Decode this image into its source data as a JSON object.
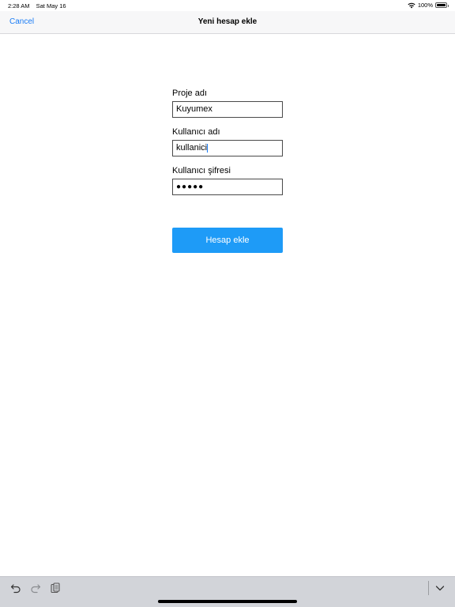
{
  "status": {
    "time": "2:28 AM",
    "date": "Sat May 16",
    "battery": "100%"
  },
  "nav": {
    "cancel_label": "Cancel",
    "title": "Yeni hesap ekle"
  },
  "form": {
    "project": {
      "label": "Proje adı",
      "value": "Kuyumex"
    },
    "username": {
      "label": "Kullanıcı adı",
      "value": "kullanici"
    },
    "password": {
      "label": "Kullanıcı şifresi",
      "value": "●●●●●"
    }
  },
  "submit_label": "Hesap ekle",
  "icons": {
    "undo": "undo-icon",
    "redo": "redo-icon",
    "paste": "paste-icon",
    "dismiss": "chevron-down-icon",
    "wifi": "wifi-icon",
    "battery": "battery-icon"
  },
  "colors": {
    "accent": "#1a7cf5",
    "button": "#1e9bf7"
  }
}
